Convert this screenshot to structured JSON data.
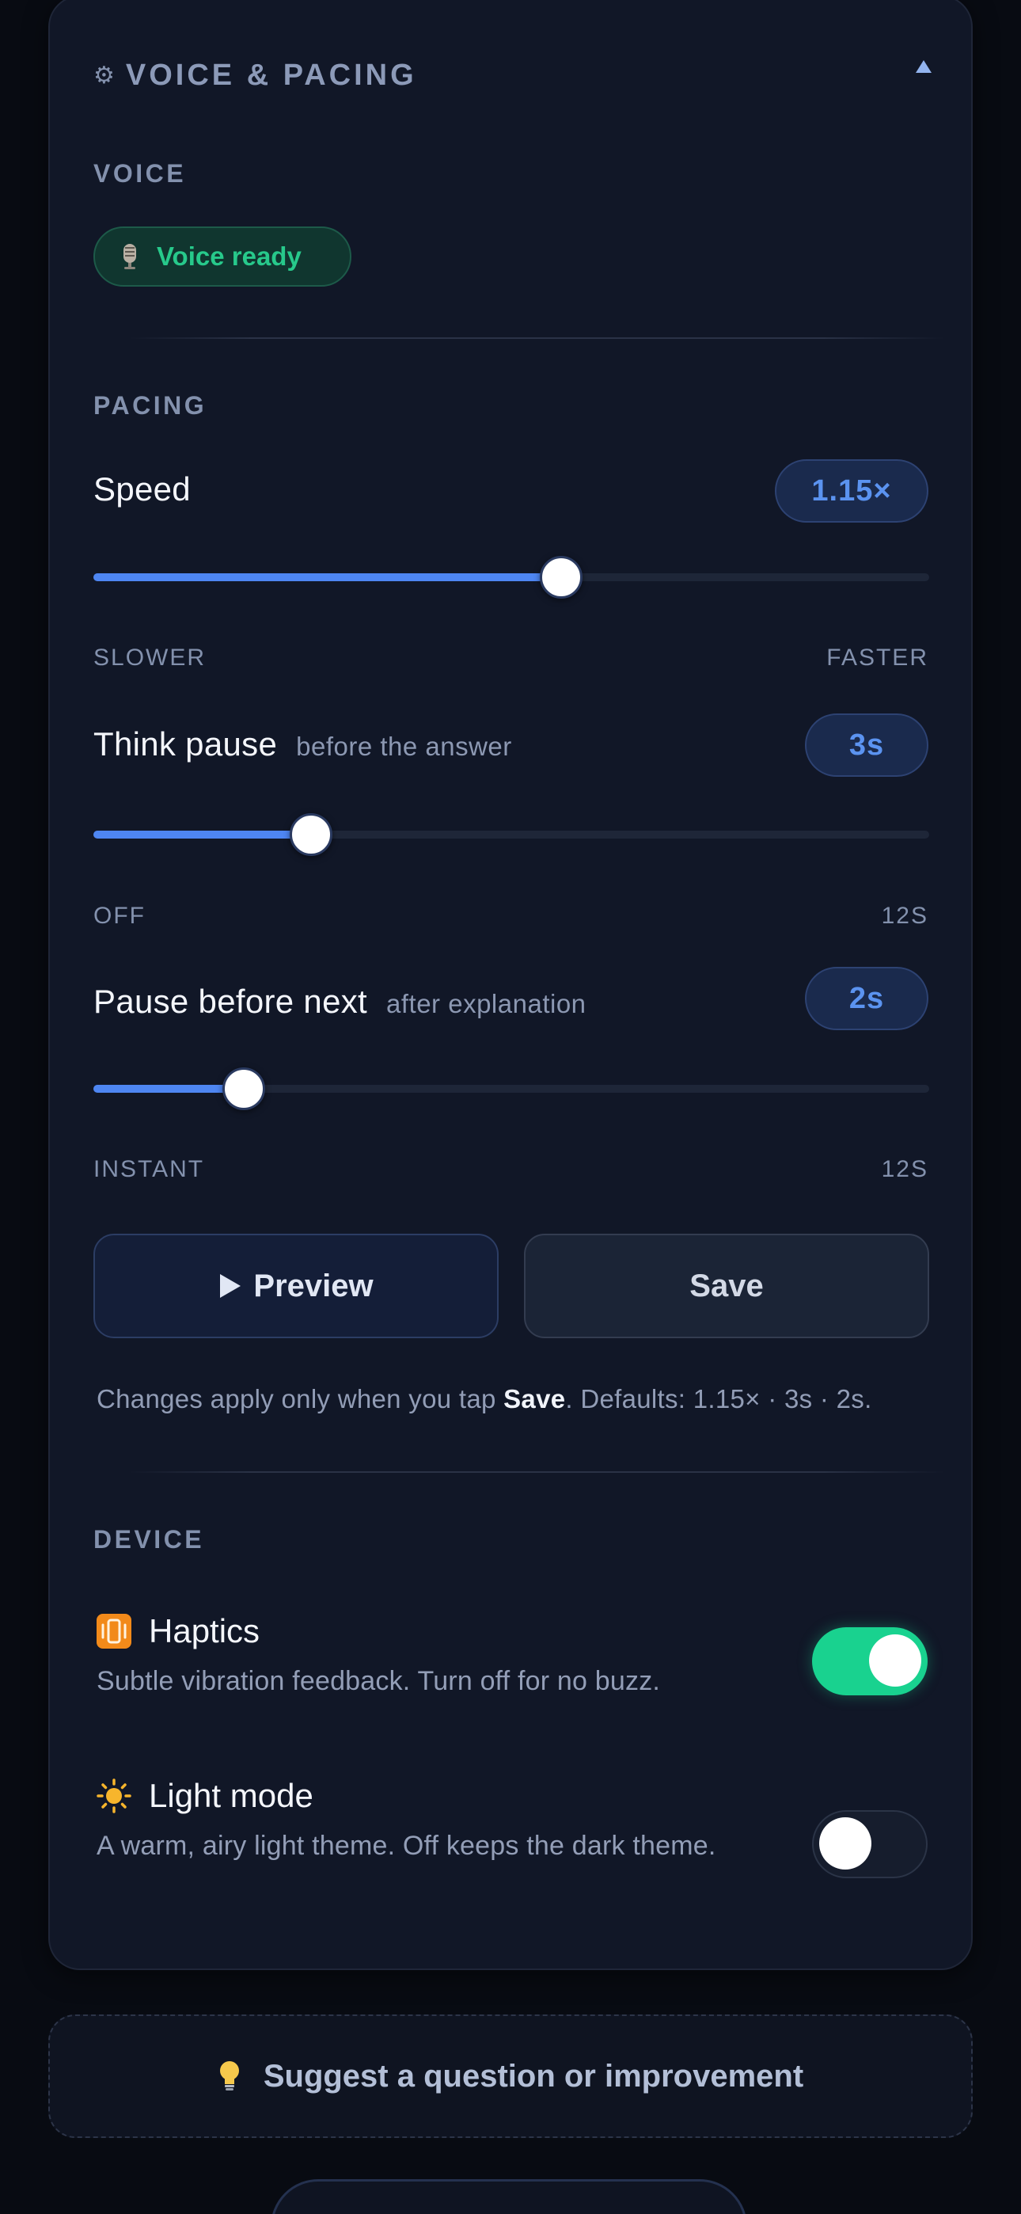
{
  "section": {
    "title": "VOICE & PACING",
    "gear_icon": "⚙"
  },
  "voice": {
    "label": "VOICE",
    "status": "Voice ready",
    "status_color": "#27c98b"
  },
  "pacing": {
    "label": "PACING",
    "speed": {
      "title": "Speed",
      "value": "1.15×",
      "fill_fraction": 0.56,
      "min_label": "SLOWER",
      "max_label": "FASTER"
    },
    "think_pause": {
      "title": "Think pause",
      "subtitle": "before the answer",
      "value": "3s",
      "fill_fraction": 0.26,
      "min_label": "OFF",
      "max_label": "12S"
    },
    "pause_next": {
      "title": "Pause before next",
      "subtitle": "after explanation",
      "value": "2s",
      "fill_fraction": 0.18,
      "min_label": "INSTANT",
      "max_label": "12S"
    }
  },
  "buttons": {
    "preview": "Preview",
    "save": "Save"
  },
  "note": {
    "before": "Changes apply only when you tap ",
    "bold": "Save",
    "after": ". Defaults: 1.15× · 3s · 2s."
  },
  "device": {
    "label": "DEVICE",
    "haptics": {
      "title": "Haptics",
      "description": "Subtle vibration feedback. Turn off for no buzz.",
      "enabled": true
    },
    "light_mode": {
      "title": "Light mode",
      "description": "A warm, airy light theme. Off keeps the dark theme.",
      "enabled": false
    }
  },
  "suggest": {
    "label": "Suggest a question or improvement"
  },
  "colors": {
    "accent": "#4e86f2",
    "success": "#19d28f",
    "background": "#080b12",
    "card": "#111727"
  }
}
